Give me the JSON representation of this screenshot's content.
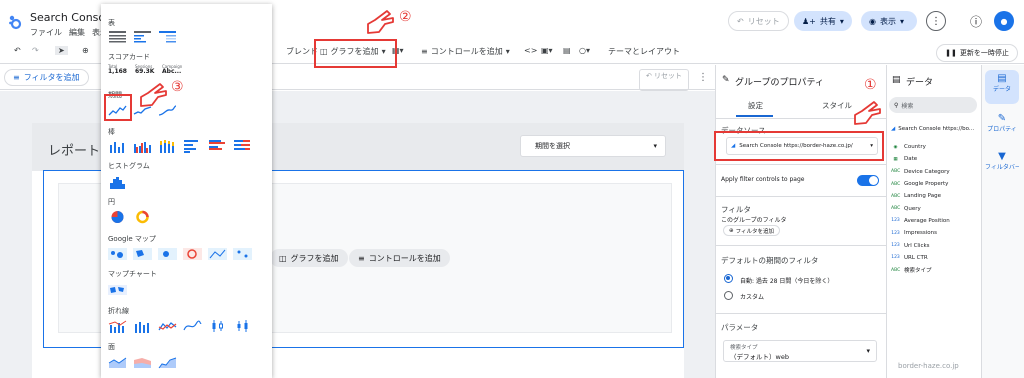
{
  "app": {
    "title": "Search Console …",
    "menu": [
      "ファイル",
      "編集",
      "表示"
    ]
  },
  "header": {
    "reset_label": "リセット",
    "share_label": "共有",
    "view_label": "表示",
    "more_icon": "more-vert-icon",
    "help_icon": "help-icon",
    "avatar_icon": "account-icon"
  },
  "toolbar": {
    "blend_label": "ブレンド",
    "add_chart_label": "グラフを追加",
    "add_control_label": "コントロールを追加",
    "theme_label": "テーマとレイアウト",
    "pause_label": "更新を一時停止"
  },
  "filterbar": {
    "add_filter_label": "フィルタを追加",
    "reset_label": "リセット"
  },
  "canvas": {
    "report_title": "レポート",
    "date_select_label": "期間を選択",
    "add_chart_label": "グラフを追加",
    "add_control_label": "コントロールを追加"
  },
  "chart_menu": {
    "sections": {
      "table": "表",
      "scorecard": "スコアカード",
      "timeseries": "期間",
      "bar": "棒",
      "histogram": "ヒストグラム",
      "pie": "円",
      "map": "Google マップ",
      "mapchart": "マップチャート",
      "line": "折れ線",
      "area": "面"
    },
    "scorecards": [
      {
        "label": "Total",
        "value": "1,168"
      },
      {
        "label": "Sessions",
        "value": "69.3K"
      },
      {
        "label": "Campaign",
        "value": "Abc..."
      }
    ]
  },
  "properties": {
    "title": "グループのプロパティ",
    "tabs": [
      "設定",
      "スタイル"
    ],
    "datasource_heading": "データソース",
    "datasource_value": "Search Console https://border-haze.co.jp/",
    "apply_filter_label": "Apply filter controls to page",
    "filter_heading": "フィルタ",
    "filter_sub": "このグループのフィルタ",
    "add_filter_label": "フィルタを追加",
    "date_heading": "デフォルトの期間のフィルタ",
    "date_auto": "自動: 過去 28 日間（今日を除く）",
    "date_custom": "カスタム",
    "param_heading": "パラメータ",
    "param_label": "検索タイプ",
    "param_value": "（デフォルト）web"
  },
  "data_panel": {
    "title": "データ",
    "search_placeholder": "検索",
    "source": "Search Console https://bo...",
    "fields": [
      {
        "type": "geo",
        "name": "Country"
      },
      {
        "type": "date",
        "name": "Date"
      },
      {
        "type": "ABC",
        "name": "Device Category"
      },
      {
        "type": "ABC",
        "name": "Google Property"
      },
      {
        "type": "ABC",
        "name": "Landing Page"
      },
      {
        "type": "ABC",
        "name": "Query"
      },
      {
        "type": "123",
        "name": "Average Position"
      },
      {
        "type": "123",
        "name": "Impressions"
      },
      {
        "type": "123",
        "name": "Url Clicks"
      },
      {
        "type": "123",
        "name": "URL CTR"
      },
      {
        "type": "ABC",
        "name": "検索タイプ"
      }
    ]
  },
  "rail": {
    "data_label": "データ",
    "props_label": "プロパティ",
    "filter_label": "フィルタバー"
  },
  "annotations": {
    "step1": "①",
    "step2": "②",
    "step3": "③",
    "color": "#e53935"
  },
  "watermark": "border-haze.co.jp",
  "colors": {
    "accent": "#1a73e8",
    "selection": "#1a73e8",
    "annotation": "#e53935"
  }
}
